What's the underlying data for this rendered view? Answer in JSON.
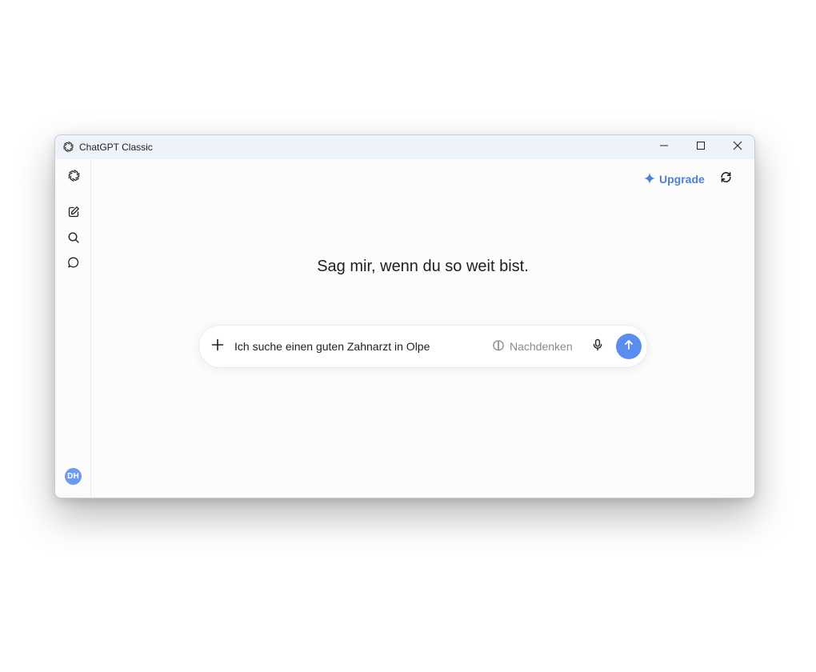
{
  "window": {
    "title": "ChatGPT Classic"
  },
  "header": {
    "upgrade_label": "Upgrade"
  },
  "main": {
    "headline": "Sag mir, wenn du so weit bist."
  },
  "composer": {
    "value": "Ich suche einen guten Zahnarzt in Olpe",
    "think_label": "Nachdenken"
  },
  "user": {
    "initials": "DH"
  },
  "icons": {
    "app": "openai-logo-icon",
    "new_chat": "edit-icon",
    "search": "search-icon",
    "chats": "chat-bubble-icon",
    "upgrade": "sparkle-icon",
    "refresh": "refresh-icon",
    "plus": "plus-icon",
    "think": "brain-icon",
    "mic": "microphone-icon",
    "send": "arrow-up-icon"
  },
  "colors": {
    "accent": "#5b8def",
    "upgrade_text": "#4f7fd6",
    "avatar": "#6d9af0",
    "titlebar": "#eef3f9"
  }
}
